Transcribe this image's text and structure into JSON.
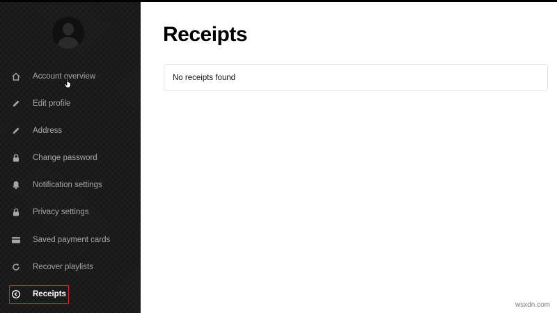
{
  "page": {
    "title": "Receipts",
    "empty_message": "No receipts found"
  },
  "sidebar": {
    "items": [
      {
        "label": "Account overview",
        "icon": "home-icon"
      },
      {
        "label": "Edit profile",
        "icon": "pencil-icon"
      },
      {
        "label": "Address",
        "icon": "pencil-icon"
      },
      {
        "label": "Change password",
        "icon": "lock-icon"
      },
      {
        "label": "Notification settings",
        "icon": "bell-icon"
      },
      {
        "label": "Privacy settings",
        "icon": "lock-icon"
      },
      {
        "label": "Saved payment cards",
        "icon": "credit-card-icon"
      },
      {
        "label": "Recover playlists",
        "icon": "refresh-icon"
      },
      {
        "label": "Receipts",
        "icon": "clock-icon",
        "active": true
      }
    ]
  },
  "watermark": "wsxdn.com",
  "colors": {
    "sidebar_bg": "#1b1b1b",
    "sidebar_text": "#a7a7a7",
    "active_text": "#ffffff",
    "highlight": "#e02424",
    "main_bg": "#ffffff"
  }
}
